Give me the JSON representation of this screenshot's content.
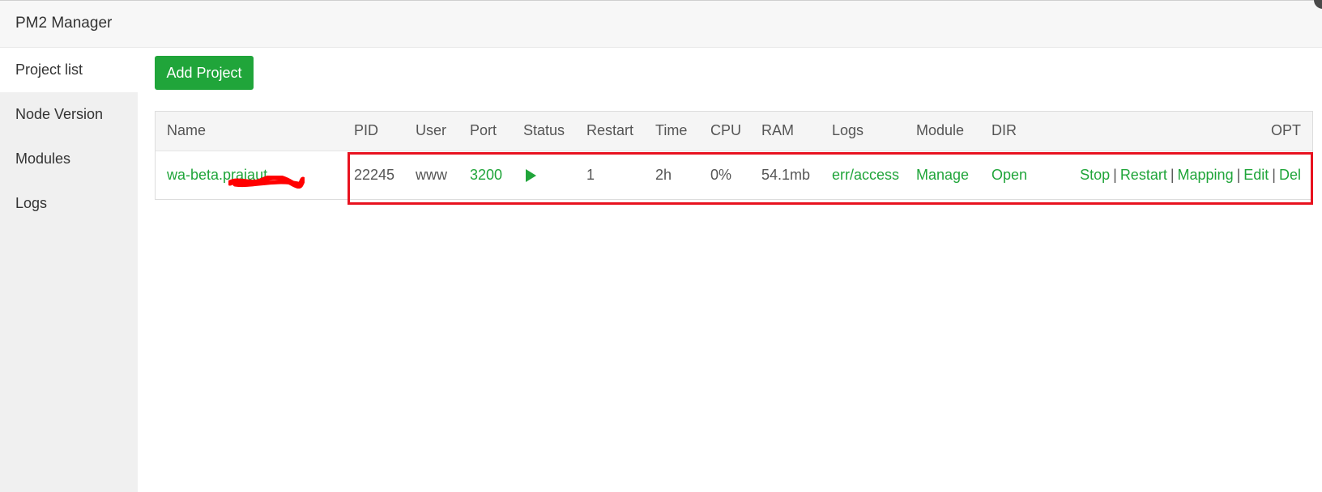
{
  "window": {
    "title": "PM2 Manager"
  },
  "sidebar": {
    "items": [
      {
        "label": "Project list",
        "active": true
      },
      {
        "label": "Node Version",
        "active": false
      },
      {
        "label": "Modules",
        "active": false
      },
      {
        "label": "Logs",
        "active": false
      }
    ]
  },
  "toolbar": {
    "add_label": "Add Project"
  },
  "table": {
    "headers": {
      "name": "Name",
      "pid": "PID",
      "user": "User",
      "port": "Port",
      "status": "Status",
      "restart": "Restart",
      "time": "Time",
      "cpu": "CPU",
      "ram": "RAM",
      "logs": "Logs",
      "module": "Module",
      "dir": "DIR",
      "opt": "OPT"
    },
    "rows": [
      {
        "name": "wa-beta.prajaut",
        "pid": "22245",
        "user": "www",
        "port": "3200",
        "status_icon": "play-icon",
        "restart": "1",
        "time": "2h",
        "cpu": "0%",
        "ram": "54.1mb",
        "logs": "err/access",
        "module": "Manage",
        "dir": "Open",
        "opt": {
          "stop": "Stop",
          "restart": "Restart",
          "mapping": "Mapping",
          "edit": "Edit",
          "del": "Del",
          "separator": "|"
        }
      }
    ]
  },
  "colors": {
    "accent": "#20a53a",
    "highlight": "#e8121f",
    "sidebar_bg": "#f0f0f0"
  }
}
